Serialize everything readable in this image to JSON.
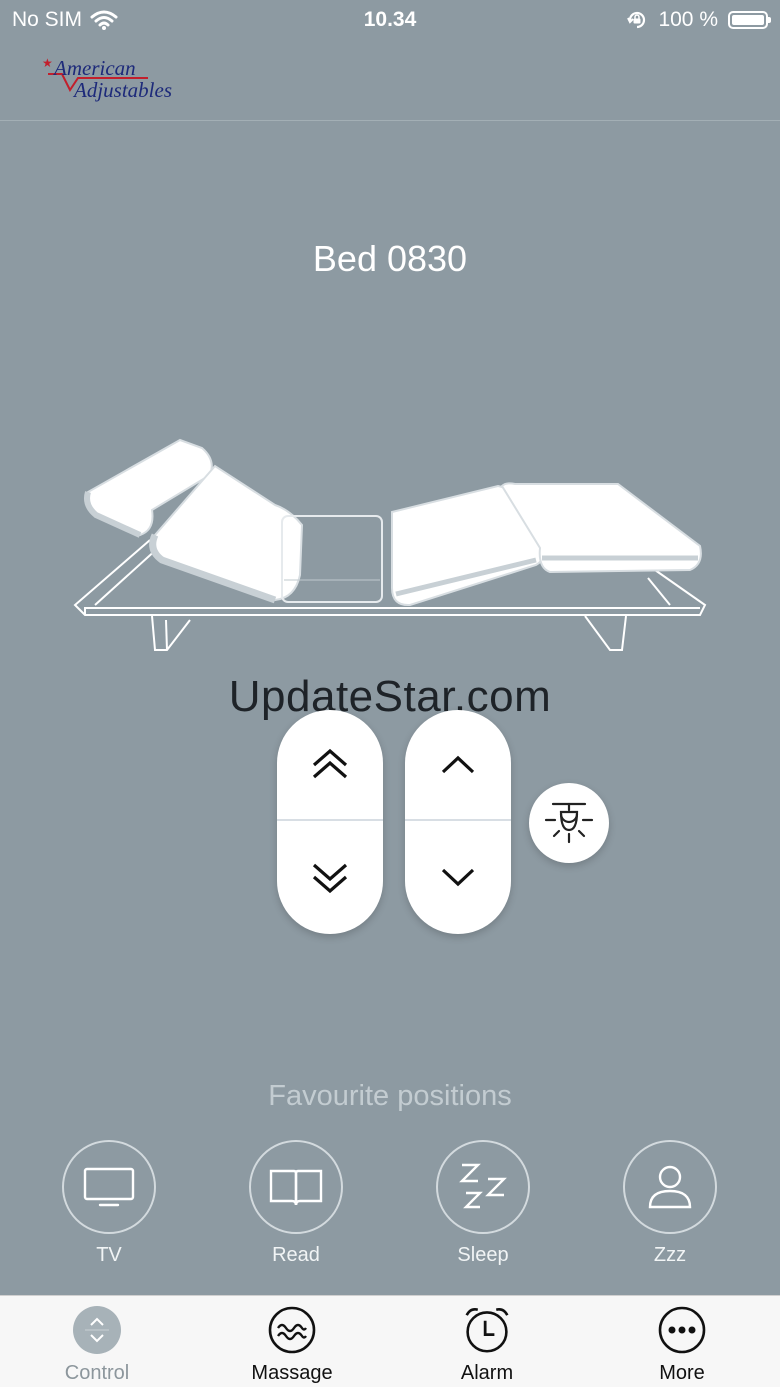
{
  "status_bar": {
    "carrier": "No SIM",
    "time": "10.34",
    "battery_percent": "100 %",
    "battery_level": 1.0
  },
  "logo": {
    "line1": "American",
    "line2": "Adjustables",
    "colors": {
      "text": "#1d2a7a",
      "accent": "#c21f2c"
    }
  },
  "bed": {
    "name": "Bed 0830"
  },
  "watermark": "UpdateStar.com",
  "controls": {
    "head": {
      "up_icon": "double-chevron-up-icon",
      "down_icon": "double-chevron-down-icon"
    },
    "foot": {
      "up_icon": "chevron-up-icon",
      "down_icon": "chevron-down-icon"
    },
    "light_icon": "under-bed-light-icon"
  },
  "favourites": {
    "title": "Favourite positions",
    "items": [
      {
        "label": "TV",
        "icon": "tv-icon"
      },
      {
        "label": "Read",
        "icon": "book-icon"
      },
      {
        "label": "Sleep",
        "icon": "zzz-icon"
      },
      {
        "label": "Zzz",
        "icon": "person-icon"
      }
    ]
  },
  "tabs": [
    {
      "label": "Control",
      "icon": "control-icon",
      "active": true
    },
    {
      "label": "Massage",
      "icon": "massage-icon",
      "active": false
    },
    {
      "label": "Alarm",
      "icon": "alarm-clock-icon",
      "active": false
    },
    {
      "label": "More",
      "icon": "more-icon",
      "active": false
    }
  ],
  "colors": {
    "background": "#8d9aa2",
    "tab_bar": "#f7f7f7",
    "active_tab_label": "#8c969c",
    "active_tab_icon": "#a7b2b8"
  }
}
